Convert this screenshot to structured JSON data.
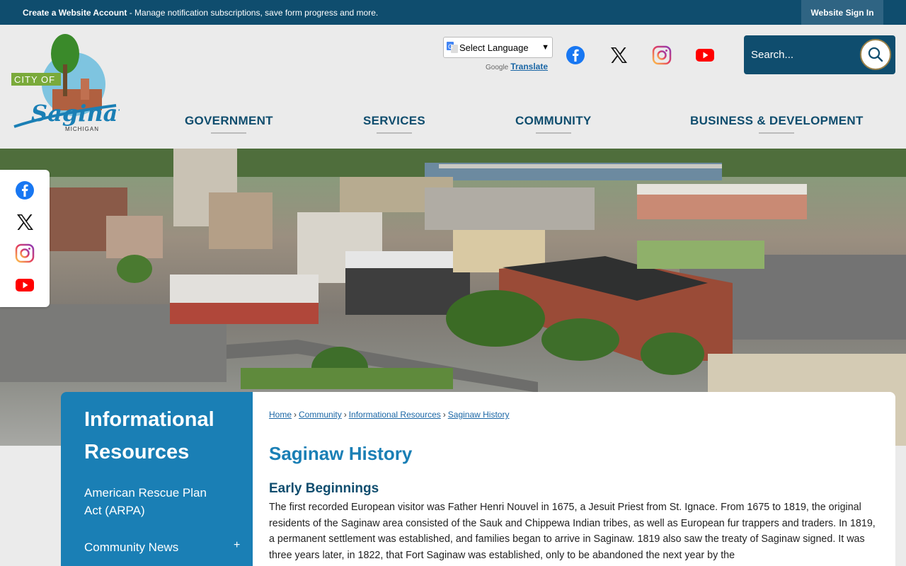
{
  "topbar": {
    "message_bold": "Create a Website Account",
    "message_rest": " - Manage notification subscriptions, save form progress and more.",
    "sign_in": "Website Sign In"
  },
  "logo": {
    "city_of": "CITY OF",
    "name": "Saginaw",
    "state": "MICHIGAN"
  },
  "translate": {
    "select_label": "Select Language",
    "powered_by": "Google",
    "translate_link": "Translate"
  },
  "search": {
    "placeholder": "Search..."
  },
  "nav": {
    "items": [
      {
        "label": "GOVERNMENT"
      },
      {
        "label": "SERVICES"
      },
      {
        "label": "COMMUNITY"
      },
      {
        "label": "BUSINESS & DEVELOPMENT"
      }
    ]
  },
  "icons": {
    "facebook": "facebook-icon",
    "x": "x-icon",
    "instagram": "instagram-icon",
    "youtube": "youtube-icon",
    "search": "search-icon"
  },
  "colors": {
    "brand_dark": "#0f4d6e",
    "brand_blue": "#1a7fb5",
    "facebook": "#1877f2",
    "youtube": "#ff0000"
  },
  "sidebar": {
    "title": "Informational Resources",
    "items": [
      {
        "label": "American Rescue Plan Act (ARPA)"
      },
      {
        "label": "Community News",
        "expand": "+"
      }
    ]
  },
  "breadcrumb": {
    "items": [
      "Home",
      "Community",
      "Informational Resources",
      "Saginaw History"
    ],
    "separator": "›"
  },
  "content": {
    "page_title": "Saginaw History",
    "section_title": "Early Beginnings",
    "paragraph": "The first recorded European visitor was Father Henri Nouvel in 1675, a Jesuit Priest from St. Ignace. From 1675 to 1819, the original residents of the Saginaw area consisted of the Sauk and Chippewa Indian tribes, as well as European fur trappers and traders. In 1819, a permanent settlement was established, and families began to arrive in Saginaw. 1819 also saw the treaty of Saginaw signed. It was three years later, in 1822, that Fort Saginaw was established, only to be abandoned the next year by the"
  }
}
